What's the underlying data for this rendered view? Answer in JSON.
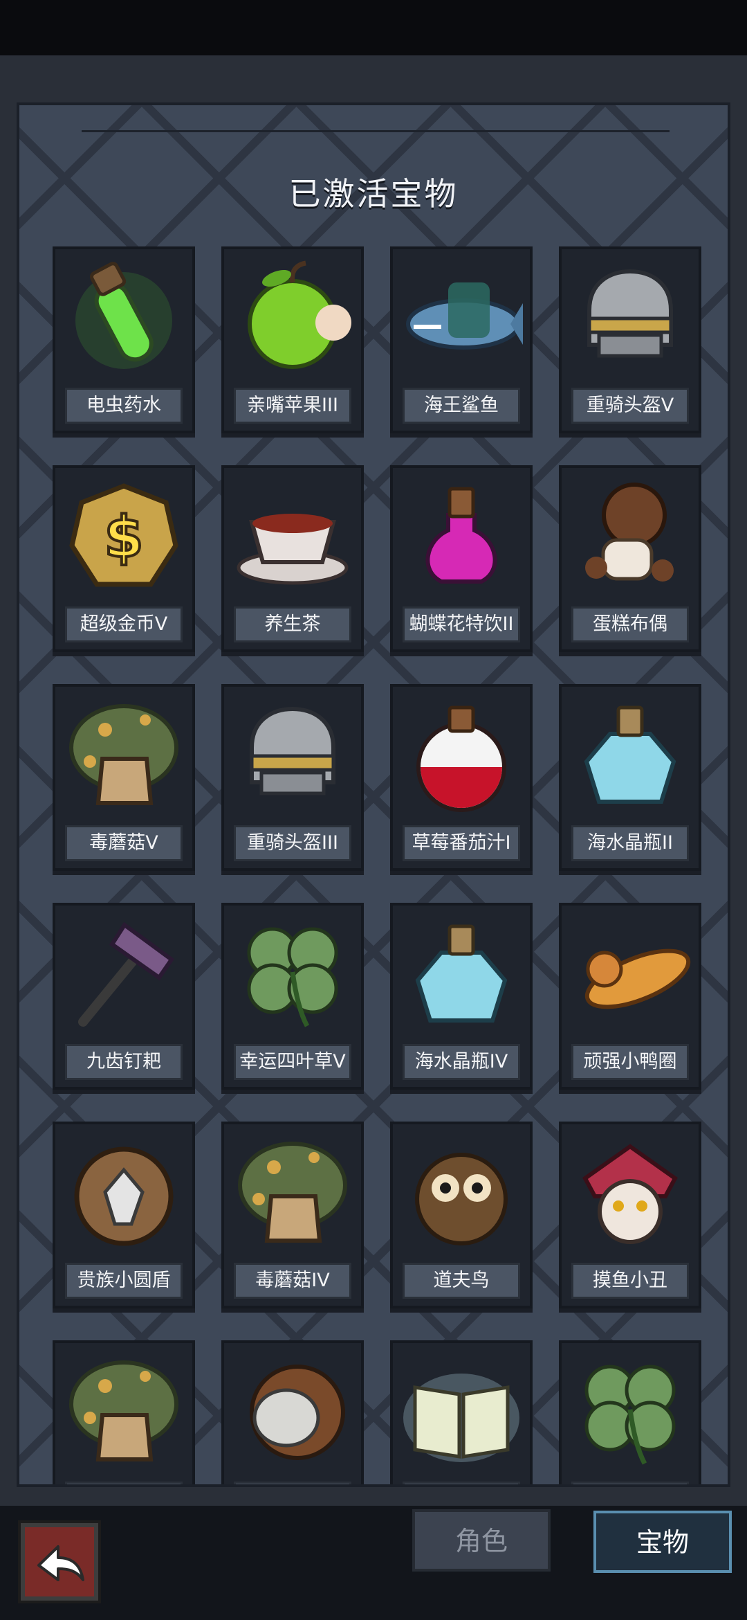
{
  "title": "已激活宝物",
  "items": [
    {
      "label": "电虫药水",
      "icon": "green-potion-icon"
    },
    {
      "label": "亲嘴苹果III",
      "icon": "bitten-apple-icon"
    },
    {
      "label": "海王鲨鱼",
      "icon": "shark-icon"
    },
    {
      "label": "重骑头盔V",
      "icon": "knight-helmet-icon"
    },
    {
      "label": "超级金币V",
      "icon": "gold-coin-icon"
    },
    {
      "label": "养生茶",
      "icon": "tea-cup-icon"
    },
    {
      "label": "蝴蝶花特饮II",
      "icon": "pink-potion-icon"
    },
    {
      "label": "蛋糕布偶",
      "icon": "voodoo-doll-icon"
    },
    {
      "label": "毒蘑菇V",
      "icon": "mushroom-icon"
    },
    {
      "label": "重骑头盔III",
      "icon": "knight-helmet-icon"
    },
    {
      "label": "草莓番茄汁I",
      "icon": "red-potion-icon"
    },
    {
      "label": "海水晶瓶II",
      "icon": "crystal-bottle-icon"
    },
    {
      "label": "九齿钉耙",
      "icon": "rake-icon"
    },
    {
      "label": "幸运四叶草V",
      "icon": "clover-icon"
    },
    {
      "label": "海水晶瓶IV",
      "icon": "crystal-bottle-icon"
    },
    {
      "label": "顽强小鸭圈",
      "icon": "swim-ring-icon"
    },
    {
      "label": "贵族小圆盾",
      "icon": "round-shield-icon"
    },
    {
      "label": "毒蘑菇IV",
      "icon": "mushroom-icon"
    },
    {
      "label": "道夫鸟",
      "icon": "owl-icon"
    },
    {
      "label": "摸鱼小丑",
      "icon": "jester-icon"
    },
    {
      "label": "",
      "icon": "mushroom-icon"
    },
    {
      "label": "",
      "icon": "masked-face-icon"
    },
    {
      "label": "",
      "icon": "book-icon"
    },
    {
      "label": "",
      "icon": "clover-icon"
    }
  ],
  "nav": {
    "back_icon": "back-arrow-icon",
    "role_tab": "角色",
    "treasure_tab": "宝物"
  }
}
